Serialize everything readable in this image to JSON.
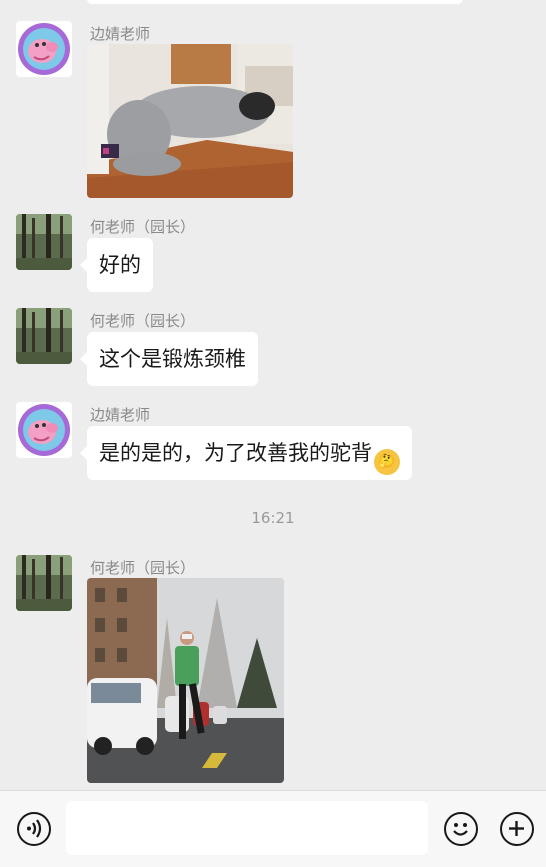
{
  "messages": [
    {
      "sender": "边婧老师",
      "type": "image",
      "image_desc": "kneeling stretch"
    },
    {
      "sender": "何老师（园长）",
      "type": "text",
      "text": "好的"
    },
    {
      "sender": "何老师（园长）",
      "type": "text",
      "text": "这个是锻炼颈椎"
    },
    {
      "sender": "边婧老师",
      "type": "text",
      "text": "是的是的，为了改善我的驼背",
      "emoji": "thinking-face"
    },
    {
      "sender": "何老师（园长）",
      "type": "image",
      "image_desc": "running on street"
    }
  ],
  "timestamp": "16:21",
  "input_bar": {
    "placeholder": "",
    "voice_icon": "voice-icon",
    "emoji_icon": "smiley-icon",
    "plus_icon": "plus-icon"
  },
  "colors": {
    "background": "#ededed",
    "bubble": "#ffffff",
    "sender_text": "#8a8a8a"
  }
}
